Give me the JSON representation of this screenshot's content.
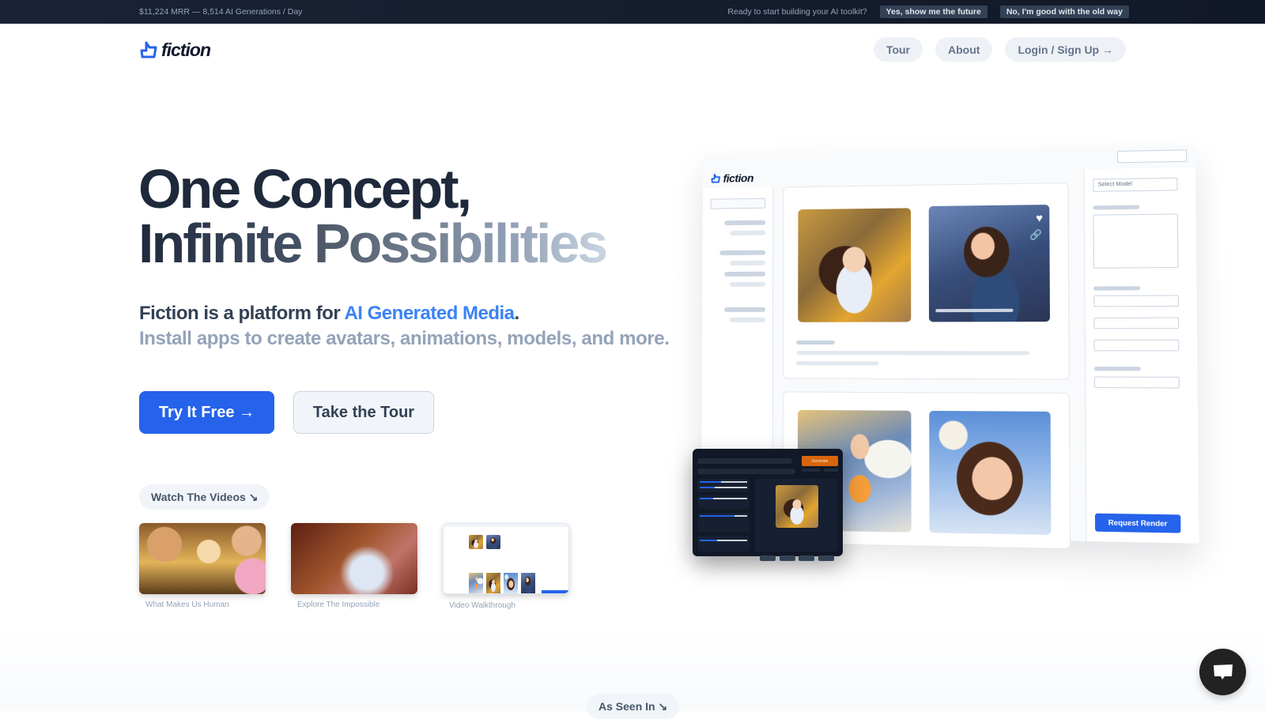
{
  "topbar": {
    "stats": "$11,224 MRR — 8,514 AI Generations / Day",
    "prompt": "Ready to start building your AI toolkit?",
    "yes_label": "Yes, show me the future",
    "no_label": "No, I'm good with the old way"
  },
  "header": {
    "logo_text": "fiction",
    "nav": [
      {
        "label": "Tour"
      },
      {
        "label": "About"
      },
      {
        "label": "Login / Sign Up →"
      }
    ]
  },
  "hero": {
    "title_line1": "One Concept,",
    "title_line2a": "Infinite ",
    "title_line2b": "Possibilities",
    "subtitle_prefix": "Fiction is a platform for ",
    "subtitle_accent": "AI Generated Media",
    "subtitle_suffix": ".",
    "subtitle2": "Install apps to create avatars, animations, models, and more.",
    "cta_primary": "Try It Free →",
    "cta_secondary": "Take the Tour",
    "accent_color": "#2563eb"
  },
  "videos": {
    "heading": "Watch The Videos ↘",
    "items": [
      {
        "label": "What Makes Us Human"
      },
      {
        "label": "Explore The Impossible"
      },
      {
        "label": "Video Walkthrough"
      }
    ]
  },
  "mockup": {
    "logo_text": "fiction",
    "select_placeholder": "Select Model",
    "request_button": "Request Render",
    "generate_button": "Generate",
    "sliders": [
      0.45,
      0.32,
      0.28,
      0.74,
      0.36
    ]
  },
  "footer_section": {
    "as_seen_in": "As Seen In ↘"
  }
}
